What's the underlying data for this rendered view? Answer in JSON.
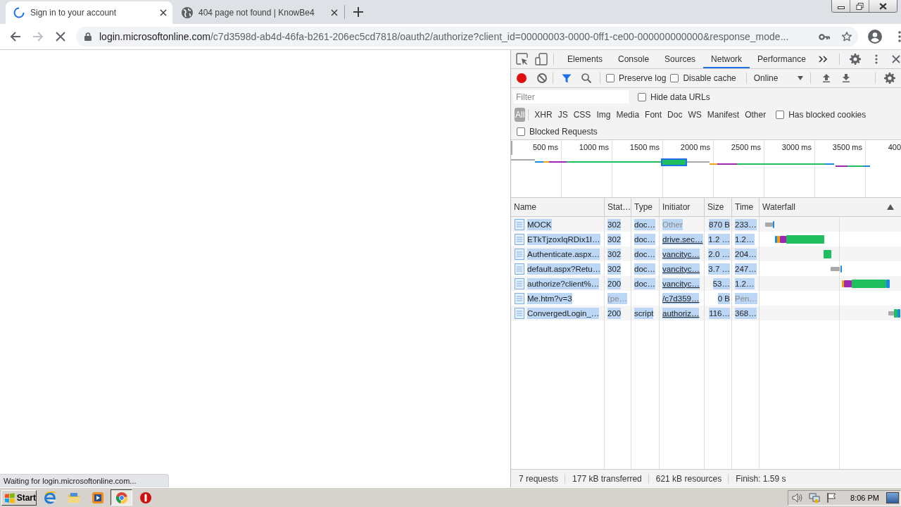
{
  "browser": {
    "tabs": [
      {
        "title": "Sign in to your account",
        "selected": true,
        "loading": true
      },
      {
        "title": "404 page not found | KnowBe4",
        "selected": false,
        "loading": false
      }
    ],
    "toolbar": {
      "forward_disabled": true,
      "loading": true,
      "url_host": "login.microsoftonline.com",
      "url_path": "/c7d3598d-ab4d-46fa-b261-206ec5cd7818/oauth2/authorize?client_id=00000003-0000-0ff1-ce00-000000000000&response_mode..."
    },
    "status_bubble": "Waiting for login.microsoftonline.com..."
  },
  "devtools": {
    "panel_tabs": [
      {
        "label": "Elements",
        "selected": false
      },
      {
        "label": "Console",
        "selected": false
      },
      {
        "label": "Sources",
        "selected": false
      },
      {
        "label": "Network",
        "selected": true
      },
      {
        "label": "Performance",
        "selected": false
      }
    ],
    "network_toolbar": {
      "recording": true,
      "filter_shown": true,
      "checkboxes": [
        {
          "label": "Preserve log",
          "checked": false
        },
        {
          "label": "Disable cache",
          "checked": false
        }
      ],
      "throttling": "Online"
    },
    "filter": {
      "placeholder": "Filter",
      "hide_data_urls": {
        "label": "Hide data URLs",
        "checked": false
      }
    },
    "type_filters": [
      {
        "label": "All",
        "selected": true
      },
      {
        "label": "XHR",
        "selected": false
      },
      {
        "label": "JS",
        "selected": false
      },
      {
        "label": "CSS",
        "selected": false
      },
      {
        "label": "Img",
        "selected": false
      },
      {
        "label": "Media",
        "selected": false
      },
      {
        "label": "Font",
        "selected": false
      },
      {
        "label": "Doc",
        "selected": false
      },
      {
        "label": "WS",
        "selected": false
      },
      {
        "label": "Manifest",
        "selected": false
      },
      {
        "label": "Other",
        "selected": false
      }
    ],
    "blocked_cookies": {
      "label": "Has blocked cookies",
      "checked": false
    },
    "blocked_requests": {
      "label": "Blocked Requests",
      "checked": false
    },
    "overview": {
      "ticks": [
        "500 ms",
        "1000 ms",
        "1500 ms",
        "2000 ms",
        "2500 ms",
        "3000 ms",
        "3500 ms",
        "400"
      ]
    },
    "table": {
      "text_selected": true,
      "columns": [
        "Name",
        "Stat…",
        "Type",
        "Initiator",
        "Size",
        "Time",
        "Waterfall"
      ],
      "rows": [
        {
          "name": "MOCK",
          "status": "302",
          "type": "doc…",
          "initiator": "Other",
          "initiator_link": false,
          "size": "870 B",
          "time": "233…",
          "pending": false
        },
        {
          "name": "ETkTjzoxIqRDix1I…",
          "status": "302",
          "type": "doc…",
          "initiator": "drive.sec…",
          "initiator_link": true,
          "size": "1.2 …",
          "time": "1.2…",
          "pending": false
        },
        {
          "name": "Authenticate.aspx…",
          "status": "302",
          "type": "doc…",
          "initiator": "vancityc…",
          "initiator_link": true,
          "size": "2.0 …",
          "time": "204…",
          "pending": false
        },
        {
          "name": "default.aspx?Retu…",
          "status": "302",
          "type": "doc…",
          "initiator": "vancityc…",
          "initiator_link": true,
          "size": "3.7 …",
          "time": "247…",
          "pending": false
        },
        {
          "name": "authorize?client%…",
          "status": "200",
          "type": "doc…",
          "initiator": "vancityc…",
          "initiator_link": true,
          "size": "53…",
          "time": "1.2…",
          "pending": false
        },
        {
          "name": "Me.htm?v=3",
          "status": "(pe…",
          "initiator": "/c7d359…",
          "initiator_link": true,
          "size": "0 B",
          "time": "Pen…",
          "pending": true
        },
        {
          "name": "ConvergedLogin_…",
          "status": "200",
          "type": "script",
          "initiator": "authoriz…",
          "initiator_link": true,
          "size": "116…",
          "time": "368…",
          "pending": false
        }
      ]
    },
    "summary": [
      "7 requests",
      "177 kB transferred",
      "621 kB resources",
      "Finish: 1.59 s"
    ]
  },
  "taskbar": {
    "start": "Start",
    "apps": [
      {
        "kind": "ie",
        "selected": false
      },
      {
        "kind": "folder",
        "selected": false
      },
      {
        "kind": "player",
        "selected": false
      },
      {
        "kind": "chrome",
        "selected": true
      },
      {
        "kind": "stop",
        "selected": false
      }
    ],
    "clock": "8:06 PM"
  }
}
